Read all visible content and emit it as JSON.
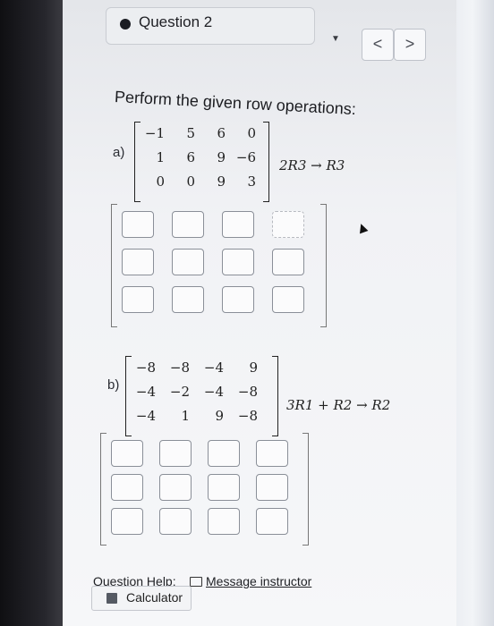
{
  "question": {
    "title": "Question 2",
    "dropdown_icon": "caret-down-icon",
    "prev_icon": "chevron-left-icon",
    "next_icon": "chevron-right-icon",
    "prev_label": "<",
    "next_label": ">"
  },
  "prompt": "Perform the given row operations:",
  "part_a": {
    "label": "a)",
    "matrix": [
      [
        "−1",
        "5",
        "6",
        "0"
      ],
      [
        "1",
        "6",
        "9",
        "−6"
      ],
      [
        "0",
        "0",
        "9",
        "3"
      ]
    ],
    "operation": "2R3 → R3"
  },
  "part_b": {
    "label": "b)",
    "matrix": [
      [
        "−8",
        "−8",
        "−4",
        "9"
      ],
      [
        "−4",
        "−2",
        "−4",
        "−8"
      ],
      [
        "−4",
        "1",
        "9",
        "−8"
      ]
    ],
    "operation": "3R1 + R2 → R2"
  },
  "footer": {
    "help_label": "Question Help:",
    "message_label": "Message instructor",
    "calculator_label": "Calculator"
  }
}
